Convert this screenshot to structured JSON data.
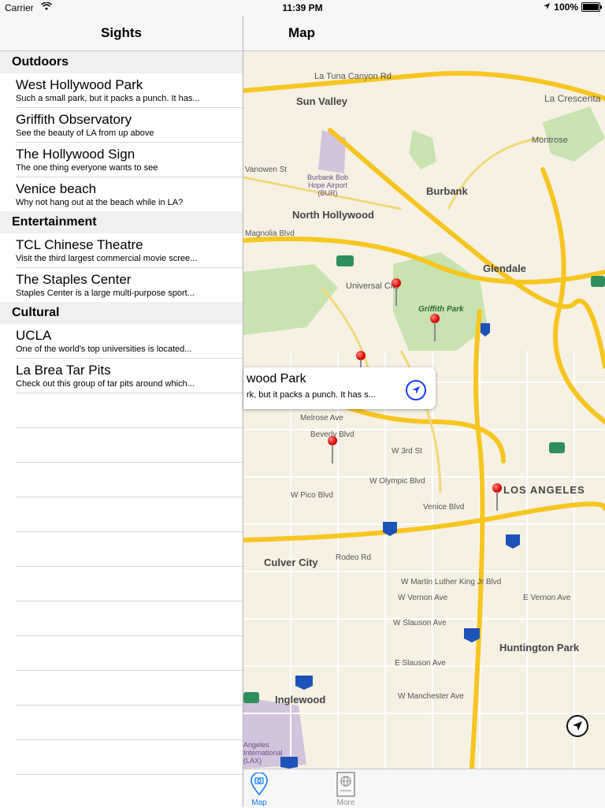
{
  "status": {
    "carrier": "Carrier",
    "time": "11:39 PM",
    "battery": "100%",
    "battery_level": 1.0
  },
  "master": {
    "title": "Sights",
    "sections": [
      {
        "header": "Outdoors",
        "items": [
          {
            "title": "West Hollywood Park",
            "subtitle": "Such a small park, but it packs a punch. It has..."
          },
          {
            "title": "Griffith Observatory",
            "subtitle": "See the beauty of LA from up above"
          },
          {
            "title": "The Hollywood Sign",
            "subtitle": "The one thing everyone wants to see"
          },
          {
            "title": "Venice beach",
            "subtitle": "Why not hang out at the beach while in LA?"
          }
        ]
      },
      {
        "header": "Entertainment",
        "items": [
          {
            "title": "TCL Chinese Theatre",
            "subtitle": "Visit the third largest commercial movie scree..."
          },
          {
            "title": "The Staples Center",
            "subtitle": "Staples Center is a large multi-purpose sport..."
          }
        ]
      },
      {
        "header": "Cultural",
        "items": [
          {
            "title": "UCLA",
            "subtitle": "One of the world's top universities is located..."
          },
          {
            "title": "La Brea Tar Pits",
            "subtitle": "Check out this group of tar pits around which..."
          }
        ]
      }
    ]
  },
  "detail": {
    "title": "Map"
  },
  "callout": {
    "title": "wood Park",
    "subtitle": "rk, but it packs a punch. It has s..."
  },
  "map_labels": {
    "la_tuna": "La Tuna Canyon Rd",
    "la_crescenta": "La Crescenta",
    "sun_valley": "Sun Valley",
    "montrose": "Montrose",
    "burbank_airport": "Burbank Bob Hope Airport (BUR)",
    "burbank": "Burbank",
    "vanowen": "Vanowen St",
    "north_hollywood": "North Hollywood",
    "magnolia": "Magnolia Blvd",
    "glendale": "Glendale",
    "universal": "Universal City",
    "griffith": "Griffith Park",
    "los_angeles": "LOS ANGELES",
    "culver": "Culver City",
    "huntington": "Huntington Park",
    "inglewood": "Inglewood",
    "melrose": "Melrose Ave",
    "beverly": "Beverly Blvd",
    "w3rd": "W 3rd St",
    "olympic": "W Olympic Blvd",
    "pico": "W Pico Blvd",
    "venice": "Venice Blvd",
    "rodeo": "Rodeo Rd",
    "mlk": "W Martin Luther King Jr Blvd",
    "vernon": "W Vernon Ave",
    "e_vernon": "E Vernon Ave",
    "slauson": "W Slauson Ave",
    "e_slauson": "E Slauson Ave",
    "manchester": "W Manchester Ave",
    "lax": "Angeles International (LAX)"
  },
  "tabs": [
    {
      "label": "Map"
    },
    {
      "label": "More"
    }
  ],
  "colors": {
    "tint": "#0a7aff",
    "map_bg": "#f6f1e3",
    "freeway": "#f7c520",
    "park": "#c8e3b0",
    "pin": "#d90000"
  }
}
